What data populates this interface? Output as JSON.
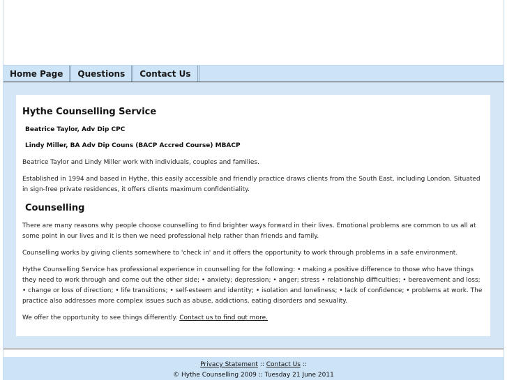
{
  "nav": {
    "items": [
      {
        "label": "Home Page"
      },
      {
        "label": "Questions"
      },
      {
        "label": "Contact Us"
      }
    ]
  },
  "content": {
    "title": "Hythe Counselling Service",
    "practitioners": [
      "Beatrice Taylor, Adv Dip CPC",
      "Lindy Miller, BA Adv Dip Couns (BACP Accred Course) MBACP"
    ],
    "intro": "Beatrice Taylor and Lindy Miller work with individuals, couples and families.",
    "established": "Established in 1994 and based in Hythe, this easily accessible and friendly practice draws clients from the South East, including London. Situated in sign-free private residences, it offers clients maximum confidentiality.",
    "section_heading": "Counselling",
    "para1": "There are many reasons why people choose counselling to find brighter ways forward in their lives. Emotional problems are common to us all at some point in our lives and it is then we need professional help rather than friends and family.",
    "para2": "Counselling works by giving clients somewhere to 'check in' and it offers the opportunity to work through problems in a safe environment.",
    "para3": "Hythe Counselling Service has professional experience in counselling for the following: • making a positive difference to those who have things they need to work through and come out the other side; • anxiety; depression; • anger; stress • relationship difficulties; • bereavement and loss; • change or loss of direction; • life transitions; • self-esteem and identity; • isolation and loneliness; • lack of confidence; • problems at work. The practice also addresses more complex issues such as abuse, addictions, eating disorders and sexuality.",
    "para4_text": "We offer the opportunity to see things differently. ",
    "para4_link": "Contact us to find out more."
  },
  "footer": {
    "privacy_link": "Privacy Statement",
    "separator": "::",
    "contact_link": "Contact Us",
    "trailing_separator": "::",
    "copyright": "© Hythe Counselling 2009 :: Tuesday 21 June 2011"
  },
  "colors": {
    "band": "#d5e6f7",
    "nav_bg": "#cde3f6",
    "rule": "#333333"
  }
}
